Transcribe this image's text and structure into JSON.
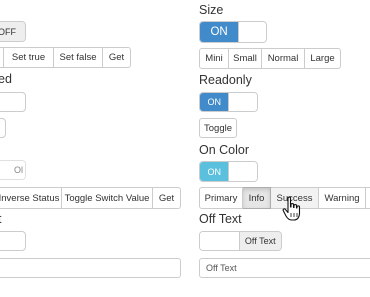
{
  "left": {
    "off_switch_label": "OFF",
    "state_buttons": [
      "Set true",
      "Set false",
      "Get"
    ],
    "disabled_heading_fragment": "ed",
    "indeterminate_fragment": "Ol",
    "toggle_buttons": [
      "Inverse Status",
      "Toggle Switch Value",
      "Get"
    ],
    "label_heading_fragment": "t"
  },
  "right": {
    "size_heading": "Size",
    "size_switch_on": "ON",
    "size_buttons": [
      "Mini",
      "Small",
      "Normal",
      "Large"
    ],
    "readonly_heading": "Readonly",
    "readonly_switch_on": "ON",
    "readonly_toggle_button": "Toggle",
    "oncolor_heading": "On Color",
    "oncolor_switch_on": "ON",
    "color_buttons": [
      "Primary",
      "Info",
      "Success",
      "Warning"
    ],
    "color_active": "Info",
    "offtext_heading": "Off Text",
    "offtext_switch_label": "Off Text",
    "offtext_input_value": "Off Text"
  },
  "colors": {
    "primary": "#428bca",
    "info": "#5bc0de",
    "off_bg": "#eeeeee",
    "border": "#cccccc"
  },
  "icons": {
    "cursor": "hand-pointer-icon"
  }
}
